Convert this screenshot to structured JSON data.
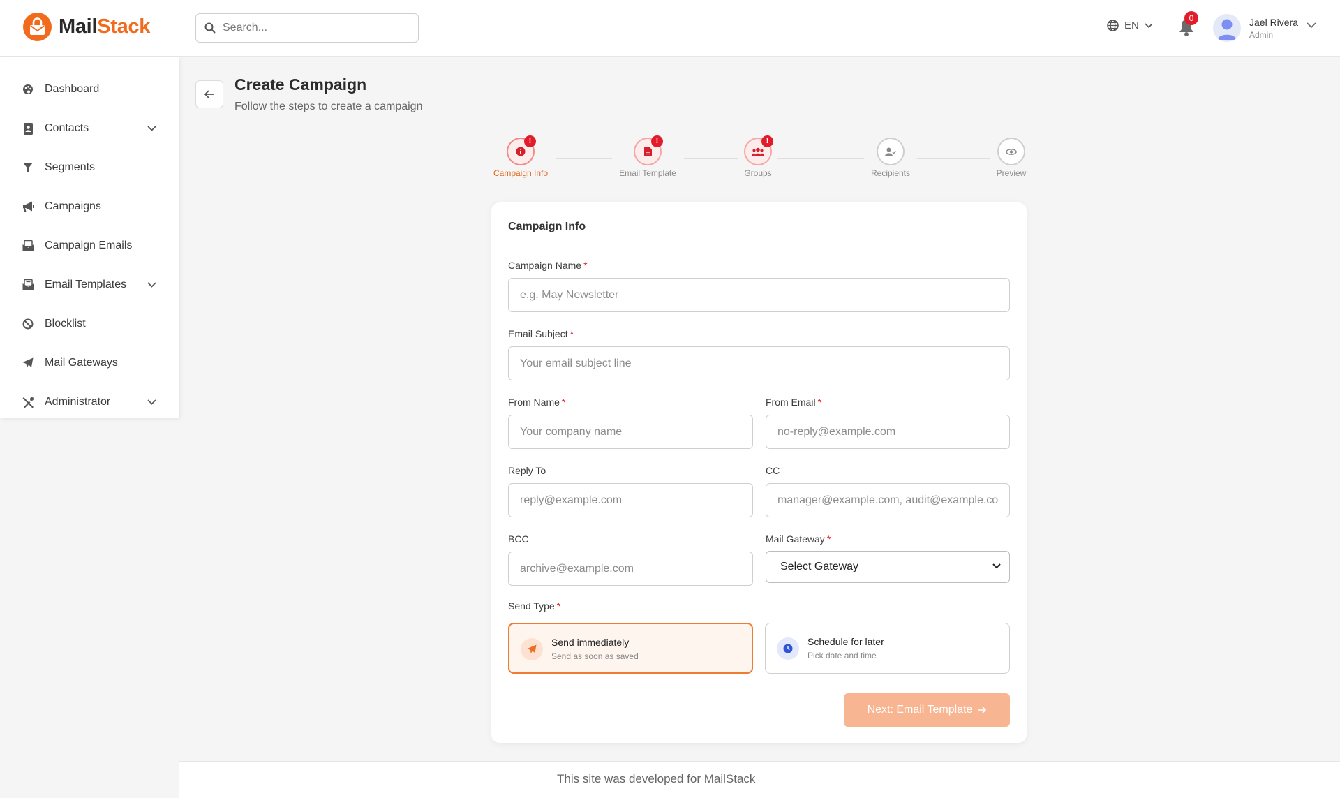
{
  "brand": {
    "name_part1": "Mail",
    "name_part2": "Stack",
    "accent_color": "#f26b1d"
  },
  "search": {
    "placeholder": "Search..."
  },
  "header": {
    "language": "EN",
    "notifications_count": "0",
    "user_name": "Jael Rivera",
    "user_role": "Admin"
  },
  "sidebar": {
    "items": [
      {
        "label": "Dashboard",
        "icon": "palette-icon",
        "has_submenu": false
      },
      {
        "label": "Contacts",
        "icon": "address-book-icon",
        "has_submenu": true
      },
      {
        "label": "Segments",
        "icon": "filter-icon",
        "has_submenu": false
      },
      {
        "label": "Campaigns",
        "icon": "megaphone-icon",
        "has_submenu": false
      },
      {
        "label": "Campaign Emails",
        "icon": "envelope-open-icon",
        "has_submenu": false
      },
      {
        "label": "Email Templates",
        "icon": "envelope-open-text-icon",
        "has_submenu": true
      },
      {
        "label": "Blocklist",
        "icon": "ban-icon",
        "has_submenu": false
      },
      {
        "label": "Mail Gateways",
        "icon": "paper-plane-icon",
        "has_submenu": false
      },
      {
        "label": "Administrator",
        "icon": "tools-icon",
        "has_submenu": true
      }
    ]
  },
  "page": {
    "title": "Create Campaign",
    "subtitle": "Follow the steps to create a campaign"
  },
  "stepper": {
    "steps": [
      {
        "label": "Campaign Info",
        "state": "active",
        "alert": "!",
        "icon": "info-icon"
      },
      {
        "label": "Email Template",
        "state": "error",
        "alert": "!",
        "icon": "file-icon"
      },
      {
        "label": "Groups",
        "state": "error",
        "alert": "!",
        "icon": "users-icon"
      },
      {
        "label": "Recipients",
        "state": "idle",
        "icon": "user-check-icon"
      },
      {
        "label": "Preview",
        "state": "idle",
        "icon": "eye-icon"
      }
    ]
  },
  "form": {
    "section_title": "Campaign Info",
    "required_mark": "*",
    "campaign_name": {
      "label": "Campaign Name",
      "placeholder": "e.g. May Newsletter",
      "value": ""
    },
    "email_subject": {
      "label": "Email Subject",
      "placeholder": "Your email subject line",
      "value": ""
    },
    "from_name": {
      "label": "From Name",
      "placeholder": "Your company name",
      "value": ""
    },
    "from_email": {
      "label": "From Email",
      "placeholder": "no-reply@example.com",
      "value": ""
    },
    "reply_to": {
      "label": "Reply To",
      "placeholder": "reply@example.com",
      "value": ""
    },
    "cc": {
      "label": "CC",
      "placeholder": "manager@example.com, audit@example.co",
      "value": ""
    },
    "bcc": {
      "label": "BCC",
      "placeholder": "archive@example.com",
      "value": ""
    },
    "mail_gateway": {
      "label": "Mail Gateway",
      "selected": "Select Gateway"
    },
    "send_type": {
      "label": "Send Type",
      "options": [
        {
          "title": "Send immediately",
          "description": "Send as soon as saved",
          "selected": true,
          "icon": "paper-plane-icon"
        },
        {
          "title": "Schedule for later",
          "description": "Pick date and time",
          "selected": false,
          "icon": "clock-icon"
        }
      ]
    },
    "next_button": "Next: Email Template"
  },
  "footer": {
    "text": "This site was developed for MailStack"
  }
}
